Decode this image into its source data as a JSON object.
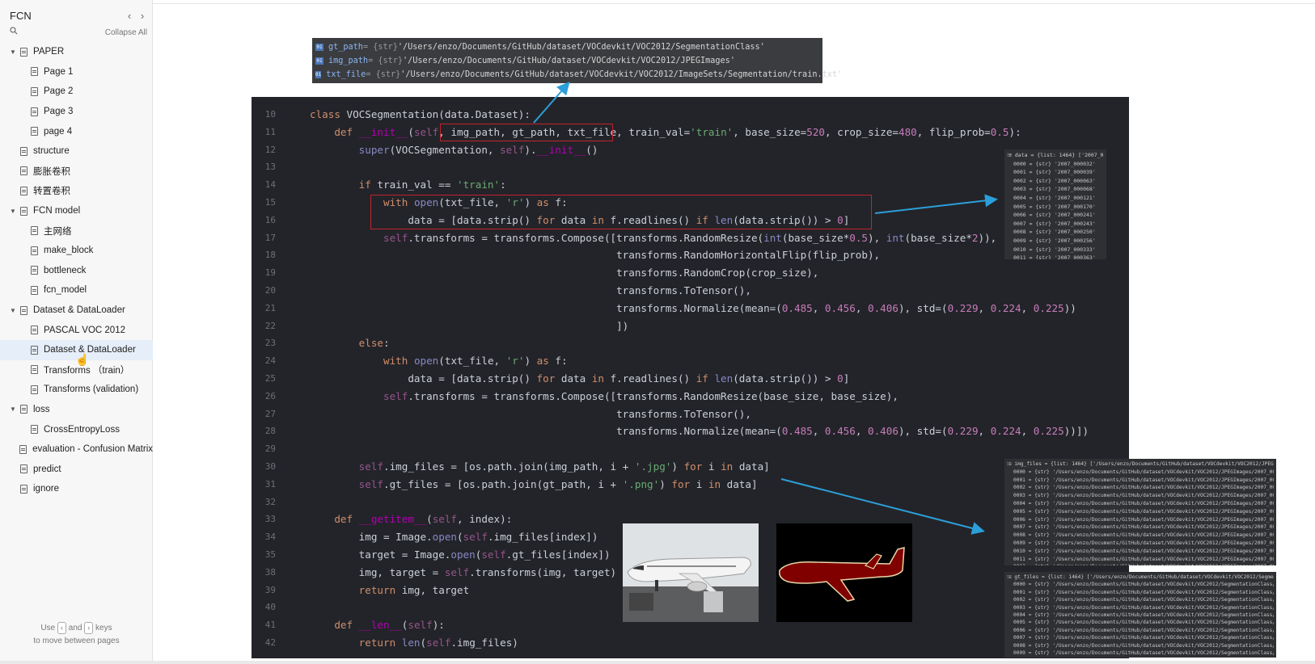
{
  "sidebar": {
    "title": "FCN",
    "collapse_all": "Collapse All",
    "nav_prev": "‹",
    "nav_next": "›",
    "hint_use": "Use",
    "hint_and": "and",
    "hint_keys": "keys",
    "hint_line2": "to move between pages",
    "key_left": "‹",
    "key_right": "›",
    "items": [
      {
        "label": "PAPER",
        "caret": "▼"
      },
      {
        "label": "Page 1"
      },
      {
        "label": "Page 2"
      },
      {
        "label": "Page 3"
      },
      {
        "label": "page 4"
      },
      {
        "label": "structure"
      },
      {
        "label": "膨胀卷积"
      },
      {
        "label": "转置卷积"
      },
      {
        "label": "FCN model",
        "caret": "▼"
      },
      {
        "label": "主网络"
      },
      {
        "label": "make_block"
      },
      {
        "label": "bottleneck"
      },
      {
        "label": "fcn_model"
      },
      {
        "label": "Dataset & DataLoader",
        "caret": "▼"
      },
      {
        "label": "PASCAL VOC 2012"
      },
      {
        "label": "Dataset & DataLoader"
      },
      {
        "label": "Transforms （train）"
      },
      {
        "label": "Transforms (validation)"
      },
      {
        "label": "loss",
        "caret": "▼"
      },
      {
        "label": "CrossEntropyLoss"
      },
      {
        "label": "evaluation - Confusion Matrix"
      },
      {
        "label": "predict"
      },
      {
        "label": "ignore"
      }
    ]
  },
  "debug_vars": [
    {
      "name": "gt_path",
      "type": "= {str}",
      "value": "'/Users/enzo/Documents/GitHub/dataset/VOCdevkit/VOC2012/SegmentationClass'"
    },
    {
      "name": "img_path",
      "type": "= {str}",
      "value": "'/Users/enzo/Documents/GitHub/dataset/VOCdevkit/VOC2012/JPEGImages'"
    },
    {
      "name": "txt_file",
      "type": "= {str}",
      "value": "'/Users/enzo/Documents/GitHub/dataset/VOCdevkit/VOC2012/ImageSets/Segmentation/train.txt'"
    }
  ],
  "code": [
    {
      "n": "10",
      "t": "class VOCSegmentation(data.Dataset):"
    },
    {
      "n": "11",
      "t": "    def __init__(self, img_path, gt_path, txt_file, train_val='train', base_size=520, crop_size=480, flip_prob=0.5):"
    },
    {
      "n": "12",
      "t": "        super(VOCSegmentation, self).__init__()"
    },
    {
      "n": "13",
      "t": ""
    },
    {
      "n": "14",
      "t": "        if train_val == 'train':"
    },
    {
      "n": "15",
      "t": "            with open(txt_file, 'r') as f:"
    },
    {
      "n": "16",
      "t": "                data = [data.strip() for data in f.readlines() if len(data.strip()) > 0]"
    },
    {
      "n": "17",
      "t": "            self.transforms = transforms.Compose([transforms.RandomResize(int(base_size*0.5), int(base_size*2)),"
    },
    {
      "n": "18",
      "t": "                                                  transforms.RandomHorizontalFlip(flip_prob),"
    },
    {
      "n": "19",
      "t": "                                                  transforms.RandomCrop(crop_size),"
    },
    {
      "n": "20",
      "t": "                                                  transforms.ToTensor(),"
    },
    {
      "n": "21",
      "t": "                                                  transforms.Normalize(mean=(0.485, 0.456, 0.406), std=(0.229, 0.224, 0.225))"
    },
    {
      "n": "22",
      "t": "                                                  ])"
    },
    {
      "n": "23",
      "t": "        else:"
    },
    {
      "n": "24",
      "t": "            with open(txt_file, 'r') as f:"
    },
    {
      "n": "25",
      "t": "                data = [data.strip() for data in f.readlines() if len(data.strip()) > 0]"
    },
    {
      "n": "26",
      "t": "            self.transforms = transforms.Compose([transforms.RandomResize(base_size, base_size),"
    },
    {
      "n": "27",
      "t": "                                                  transforms.ToTensor(),"
    },
    {
      "n": "28",
      "t": "                                                  transforms.Normalize(mean=(0.485, 0.456, 0.406), std=(0.229, 0.224, 0.225))])"
    },
    {
      "n": "29",
      "t": ""
    },
    {
      "n": "30",
      "t": "        self.img_files = [os.path.join(img_path, i + '.jpg') for i in data]"
    },
    {
      "n": "31",
      "t": "        self.gt_files = [os.path.join(gt_path, i + '.png') for i in data]"
    },
    {
      "n": "32",
      "t": ""
    },
    {
      "n": "33",
      "t": "    def __getitem__(self, index):"
    },
    {
      "n": "34",
      "t": "        img = Image.open(self.img_files[index])"
    },
    {
      "n": "35",
      "t": "        target = Image.open(self.gt_files[index])"
    },
    {
      "n": "38",
      "t": "        img, target = self.transforms(img, target)"
    },
    {
      "n": "39",
      "t": "        return img, target"
    },
    {
      "n": "40",
      "t": ""
    },
    {
      "n": "41",
      "t": "    def __len__(self):"
    },
    {
      "n": "42",
      "t": "        return len(self.img_files)"
    }
  ],
  "data_popup": {
    "header": "data = {list: 1464} ['2007_000032',",
    "rows": [
      "0000 = {str} '2007_000032'",
      "0001 = {str} '2007_000039'",
      "0002 = {str} '2007_000063'",
      "0003 = {str} '2007_000068'",
      "0004 = {str} '2007_000121'",
      "0005 = {str} '2007_000170'",
      "0006 = {str} '2007_000241'",
      "0007 = {str} '2007_000243'",
      "0008 = {str} '2007_000250'",
      "0009 = {str} '2007_000256'",
      "0010 = {str} '2007_000333'",
      "0011 = {str} '2007_000363'"
    ]
  },
  "img_files_popup": {
    "header": "img_files = {list: 1464} ['/Users/enzo/Documents/GitHub/dataset/VOCdevkit/VOC2012/JPEGImages/2007_000",
    "rows": [
      "0000 = {str} '/Users/enzo/Documents/GitHub/dataset/VOCdevkit/VOC2012/JPEGImages/2007_000032.jpg'",
      "0001 = {str} '/Users/enzo/Documents/GitHub/dataset/VOCdevkit/VOC2012/JPEGImages/2007_000039.jpg'",
      "0002 = {str} '/Users/enzo/Documents/GitHub/dataset/VOCdevkit/VOC2012/JPEGImages/2007_000063.jpg'",
      "0003 = {str} '/Users/enzo/Documents/GitHub/dataset/VOCdevkit/VOC2012/JPEGImages/2007_000068.jpg'",
      "0004 = {str} '/Users/enzo/Documents/GitHub/dataset/VOCdevkit/VOC2012/JPEGImages/2007_000121.jpg'",
      "0005 = {str} '/Users/enzo/Documents/GitHub/dataset/VOCdevkit/VOC2012/JPEGImages/2007_000170.jpg'",
      "0006 = {str} '/Users/enzo/Documents/GitHub/dataset/VOCdevkit/VOC2012/JPEGImages/2007_000241.jpg'",
      "0007 = {str} '/Users/enzo/Documents/GitHub/dataset/VOCdevkit/VOC2012/JPEGImages/2007_000243.jpg'",
      "0008 = {str} '/Users/enzo/Documents/GitHub/dataset/VOCdevkit/VOC2012/JPEGImages/2007_000250.jpg'",
      "0009 = {str} '/Users/enzo/Documents/GitHub/dataset/VOCdevkit/VOC2012/JPEGImages/2007_000256.jpg'",
      "0010 = {str} '/Users/enzo/Documents/GitHub/dataset/VOCdevkit/VOC2012/JPEGImages/2007_000333.jpg'",
      "0011 = {str} '/Users/enzo/Documents/GitHub/dataset/VOCdevkit/VOC2012/JPEGImages/2007_000363.jpg'",
      "0012 = {str} '/Users/enzo/Documents/GitHub/dataset/VOCdevkit/VOC2012/JPEGImages/2007_000364.jpg'"
    ]
  },
  "gt_files_popup": {
    "header": "gt_files = {list: 1464} ['/Users/enzo/Documents/GitHub/dataset/VOCdevkit/VOC2012/SegmentationClass/2007_000032.png",
    "rows": [
      "0000 = {str} '/Users/enzo/Documents/GitHub/dataset/VOCdevkit/VOC2012/SegmentationClass/2007_000032.png'",
      "0001 = {str} '/Users/enzo/Documents/GitHub/dataset/VOCdevkit/VOC2012/SegmentationClass/2007_000039.png'",
      "0002 = {str} '/Users/enzo/Documents/GitHub/dataset/VOCdevkit/VOC2012/SegmentationClass/2007_000063.png'",
      "0003 = {str} '/Users/enzo/Documents/GitHub/dataset/VOCdevkit/VOC2012/SegmentationClass/2007_000068.png'",
      "0004 = {str} '/Users/enzo/Documents/GitHub/dataset/VOCdevkit/VOC2012/SegmentationClass/2007_000121.png'",
      "0005 = {str} '/Users/enzo/Documents/GitHub/dataset/VOCdevkit/VOC2012/SegmentationClass/2007_000170.png'",
      "0006 = {str} '/Users/enzo/Documents/GitHub/dataset/VOCdevkit/VOC2012/SegmentationClass/2007_000241.png'",
      "0007 = {str} '/Users/enzo/Documents/GitHub/dataset/VOCdevkit/VOC2012/SegmentationClass/2007_000243.png'",
      "0008 = {str} '/Users/enzo/Documents/GitHub/dataset/VOCdevkit/VOC2012/SegmentationClass/2007_000250.png'",
      "0009 = {str} '/Users/enzo/Documents/GitHub/dataset/VOCdevkit/VOC2012/SegmentationClass/2007_000256.png'",
      "0010 = {str} '/Users/enzo/Documents/GitHub/dataset/VOCdevkit/VOC2012/SegmentationClass/2007_000333.png'"
    ]
  },
  "colors": {
    "accent_arrow": "#2b9fd9",
    "highlight_box": "#c0232c",
    "selected_item": "#e5eef9"
  },
  "icons": {
    "search": "search-icon",
    "doc": "document-icon",
    "caret": "caret-down-icon"
  }
}
